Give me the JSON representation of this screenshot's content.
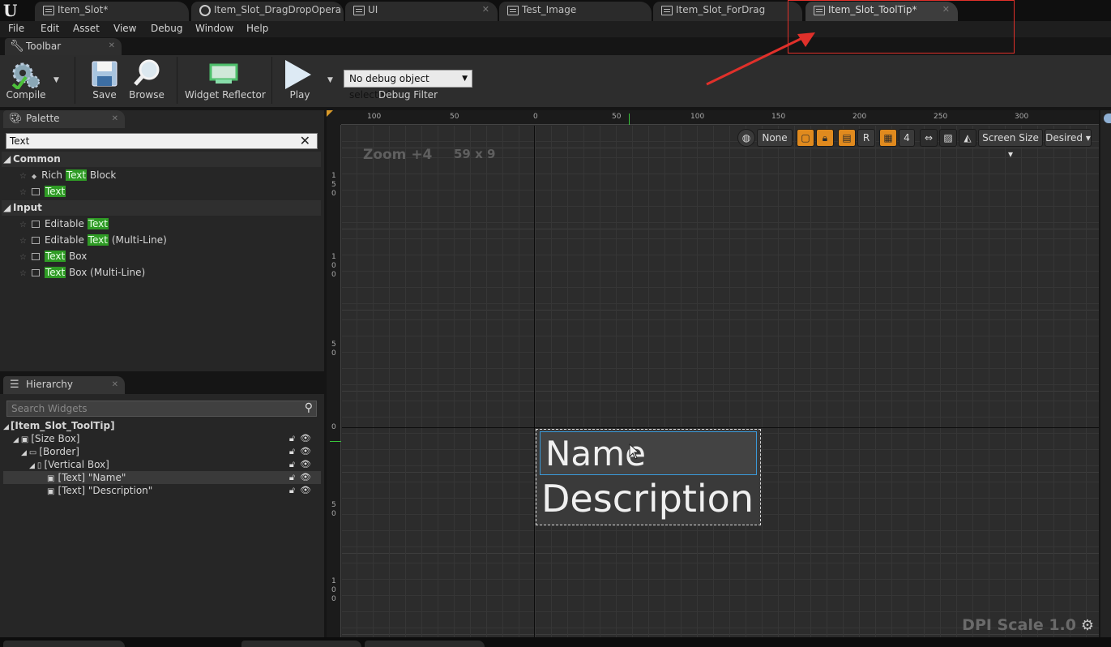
{
  "tabs": [
    {
      "label": "Item_Slot*",
      "active": false
    },
    {
      "label": "Item_Slot_DragDropOpera",
      "active": false
    },
    {
      "label": "UI",
      "active": false
    },
    {
      "label": "Test_Image",
      "active": false
    },
    {
      "label": "Item_Slot_ForDrag",
      "active": false
    },
    {
      "label": "Item_Slot_ToolTip*",
      "active": true
    }
  ],
  "menu": [
    "File",
    "Edit",
    "Asset",
    "View",
    "Debug",
    "Window",
    "Help"
  ],
  "toolbar": {
    "tab_label": "Toolbar",
    "compile": "Compile",
    "save": "Save",
    "browse": "Browse",
    "widget_reflector": "Widget Reflector",
    "play": "Play",
    "debug_select": "No debug object selected",
    "debug_filter": "Debug Filter"
  },
  "palette": {
    "tab_label": "Palette",
    "search_value": "Text",
    "categories": [
      {
        "name": "Common",
        "items": [
          {
            "pre": "Rich ",
            "hl": "Text",
            "post": " Block"
          },
          {
            "pre": "",
            "hl": "Text",
            "post": ""
          }
        ]
      },
      {
        "name": "Input",
        "items": [
          {
            "pre": "Editable ",
            "hl": "Text",
            "post": ""
          },
          {
            "pre": "Editable ",
            "hl": "Text",
            "post": " (Multi-Line)"
          },
          {
            "pre": "",
            "hl": "Text",
            "post": " Box"
          },
          {
            "pre": "",
            "hl": "Text",
            "post": " Box (Multi-Line)"
          }
        ]
      }
    ]
  },
  "hierarchy": {
    "tab_label": "Hierarchy",
    "search_placeholder": "Search Widgets",
    "root": "[Item_Slot_ToolTip]",
    "rows": [
      {
        "label": "[Size Box]",
        "selected": false
      },
      {
        "label": "[Border]",
        "selected": false
      },
      {
        "label": "[Vertical Box]",
        "selected": false
      },
      {
        "label": "[Text] \"Name\"",
        "selected": true
      },
      {
        "label": "[Text] \"Description\"",
        "selected": false
      }
    ]
  },
  "designer": {
    "zoom": "Zoom +4",
    "size": "59 x 9",
    "dpi_scale": "DPI Scale 1.0",
    "ruler_top": [
      "100",
      "50",
      "0",
      "50",
      "100",
      "150",
      "200",
      "250",
      "300"
    ],
    "ruler_left": [
      "150",
      "100",
      "50",
      "0",
      "50",
      "100"
    ],
    "view_buttons": {
      "none": "None",
      "r": "R",
      "four": "4",
      "screen_size": "Screen Size",
      "desired": "Desired"
    },
    "widget_name": "Name",
    "widget_description": "Description"
  },
  "colors": {
    "accent_orange": "#e08a1e",
    "highlight_green": "#2f9b25",
    "selection_blue": "#3a9ad9",
    "annotation_red": "#e0302a"
  }
}
